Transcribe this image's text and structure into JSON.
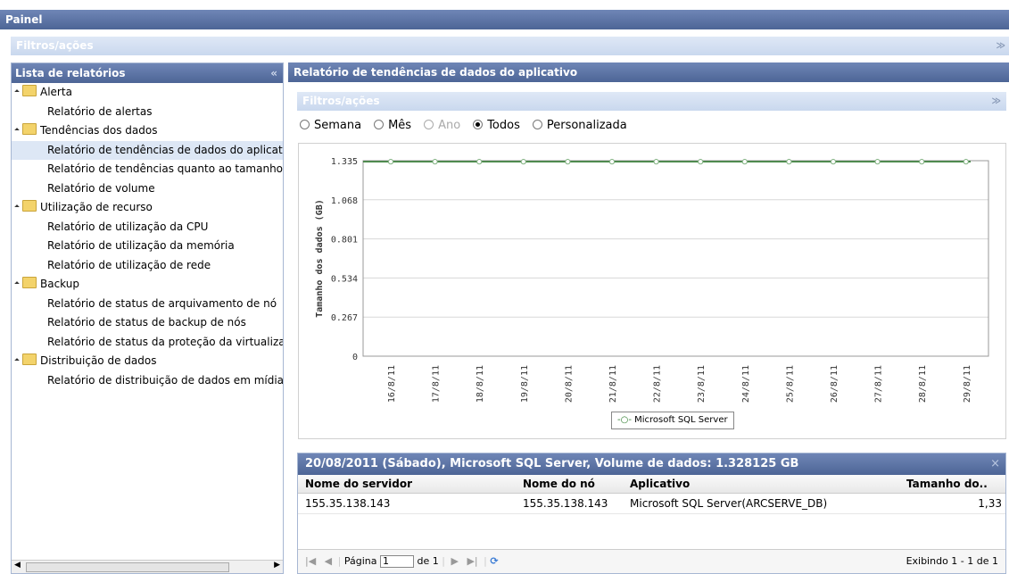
{
  "header": {
    "title": "Painel"
  },
  "top_filter": {
    "label": "Filtros/ações",
    "toggle_icon": "double-chevron-down-icon"
  },
  "sidebar": {
    "title": "Lista de relatórios",
    "collapse_icon": "double-chevron-left-icon",
    "groups": [
      {
        "label": "Alerta",
        "items": [
          "Relatório de alertas"
        ]
      },
      {
        "label": "Tendências dos dados",
        "items": [
          "Relatório de tendências de dados do aplicativo",
          "Relatório de tendências quanto ao tamanho do",
          "Relatório de volume"
        ]
      },
      {
        "label": "Utilização de recurso",
        "items": [
          "Relatório de utilização da CPU",
          "Relatório de utilização da memória",
          "Relatório de utilização de rede"
        ]
      },
      {
        "label": "Backup",
        "items": [
          "Relatório de status de arquivamento de nó",
          "Relatório de status de backup de nós",
          "Relatório de status da proteção da virtualização"
        ]
      },
      {
        "label": "Distribuição de dados",
        "items": [
          "Relatório de distribuição de dados em mídias"
        ]
      }
    ],
    "selected_item": "Relatório de tendências de dados do aplicativo"
  },
  "report": {
    "title": "Relatório de tendências de dados do aplicativo",
    "filter_label": "Filtros/ações",
    "periods": [
      "Semana",
      "Mês",
      "Ano",
      "Todos",
      "Personalizada"
    ],
    "selected_period": "Todos",
    "disabled_period": "Ano"
  },
  "chart_data": {
    "type": "line",
    "ylabel": "Tamanho dos dados (GB)",
    "xlabel": "",
    "y_ticks": [
      "1.335",
      "1.068",
      "0.801",
      "0.534",
      "0.267",
      "0"
    ],
    "ylim": [
      0,
      1.335
    ],
    "x": [
      "16/8/11",
      "17/8/11",
      "18/8/11",
      "19/8/11",
      "20/8/11",
      "21/8/11",
      "22/8/11",
      "23/8/11",
      "24/8/11",
      "25/8/11",
      "26/8/11",
      "27/8/11",
      "28/8/11",
      "29/8/11"
    ],
    "series": [
      {
        "name": "Microsoft SQL Server",
        "color": "#2e7d2e",
        "values": [
          1.328,
          1.328,
          1.328,
          1.328,
          1.328,
          1.328,
          1.328,
          1.328,
          1.328,
          1.328,
          1.328,
          1.328,
          1.328,
          1.328
        ]
      }
    ],
    "grid": true,
    "legend": "bottom"
  },
  "detail": {
    "title": "20/08/2011 (Sábado), Microsoft SQL Server, Volume de dados: 1.328125 GB",
    "close_icon": "close-icon",
    "columns": [
      "Nome do servidor",
      "Nome do nó",
      "Aplicativo",
      "Tamanho do.."
    ],
    "rows": [
      [
        "155.35.138.143",
        "155.35.138.143",
        "Microsoft SQL Server(ARCSERVE_DB)",
        "1,33"
      ]
    ],
    "pager": {
      "page_label": "Página",
      "page_value": "1",
      "of_label": "de 1",
      "status": "Exibindo 1 - 1 de 1"
    }
  }
}
